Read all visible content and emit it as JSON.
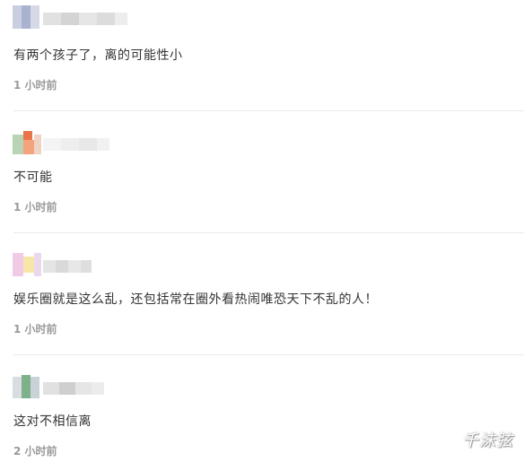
{
  "comments": [
    {
      "text": "有两个孩子了，离的可能性小",
      "time": "1 小时前"
    },
    {
      "text": "不可能",
      "time": "1 小时前"
    },
    {
      "text": "娱乐圈就是这么乱，还包括常在圈外看热闹唯恐天下不乱的人！",
      "time": "1 小时前"
    },
    {
      "text": "这对不相信离",
      "time": "2 小时前"
    }
  ],
  "watermark": "千沫弦",
  "colors": {
    "text": "#333333",
    "timestamp": "#999999",
    "divider": "#e9e9e9"
  }
}
